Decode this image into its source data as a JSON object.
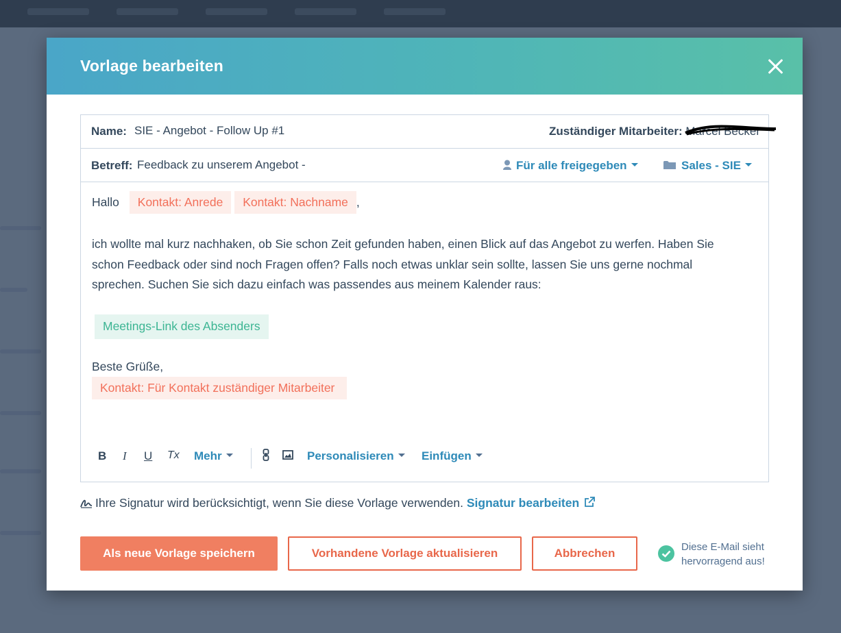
{
  "modal": {
    "title": "Vorlage bearbeiten",
    "name_label": "Name:",
    "name_value": "SIE -  Angebot - Follow Up #1",
    "owner_label": "Zuständiger Mitarbeiter:",
    "owner_value": "Marcel Becker",
    "subject_label": "Betreff:",
    "subject_value": "Feedback zu unserem Angebot -",
    "sharing_dropdown": "Für alle freigegeben",
    "folder_dropdown": "Sales - SIE"
  },
  "body": {
    "greeting": "Hallo",
    "token_anrede": "Kontakt: Anrede",
    "token_nachname": "Kontakt: Nachname",
    "comma": ",",
    "paragraph": "ich wollte mal kurz nachhaken, ob Sie schon Zeit gefunden haben, einen Blick auf das Angebot zu werfen. Haben Sie schon Feedback oder sind noch Fragen offen? Falls noch etwas unklar sein sollte, lassen Sie uns gerne nochmal sprechen. Suchen Sie sich dazu einfach was passendes aus meinem Kalender raus:",
    "token_meetings": "Meetings-Link des Absenders",
    "closing": "Beste Grüße,",
    "token_owner": "Kontakt: Für Kontakt zuständiger Mitarbeiter"
  },
  "toolbar": {
    "bold": "B",
    "italic": "I",
    "underline": "U",
    "clear": "Tx",
    "more": "Mehr",
    "personalize": "Personalisieren",
    "insert": "Einfügen"
  },
  "signature": {
    "text": "Ihre Signatur wird berücksichtigt, wenn Sie diese Vorlage verwenden.",
    "link": "Signatur bearbeiten"
  },
  "buttons": {
    "save_new": "Als neue Vorlage speichern",
    "update": "Vorhandene Vorlage aktualisieren",
    "cancel": "Abbrechen"
  },
  "status": {
    "line1": "Diese E-Mail sieht",
    "line2": "hervorragend aus!"
  },
  "colors": {
    "header_start": "#4aa6c8",
    "header_end": "#59c0a8",
    "primary": "#f07f61",
    "link": "#2e8ab8",
    "token_bg": "#fdeeea",
    "token_text": "#f2705a",
    "success": "#4cc3a0"
  }
}
